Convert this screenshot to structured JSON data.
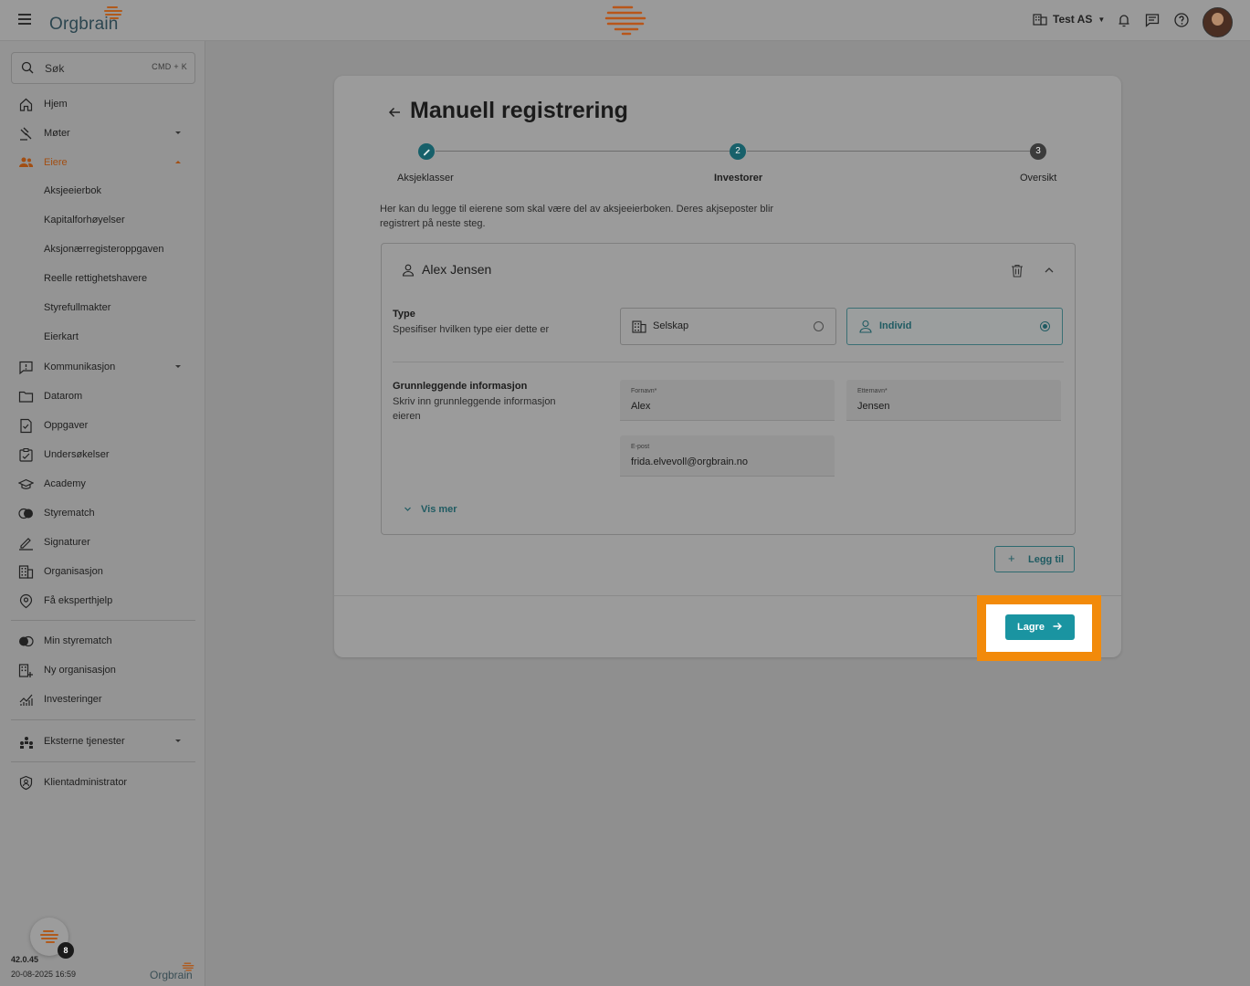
{
  "topbar": {
    "logo_text": "Orgbrain",
    "org_name": "Test AS"
  },
  "search": {
    "label": "Søk",
    "shortcut": "CMD + K"
  },
  "sidebar": {
    "items": [
      {
        "label": "Hjem",
        "icon": "home-icon"
      },
      {
        "label": "Møter",
        "icon": "gavel-icon",
        "expandable": true
      },
      {
        "label": "Eiere",
        "icon": "people-icon",
        "expandable": true,
        "active": true
      },
      {
        "label": "Kommunikasjon",
        "icon": "chat-alert-icon",
        "expandable": true
      },
      {
        "label": "Datarom",
        "icon": "folder-icon"
      },
      {
        "label": "Oppgaver",
        "icon": "task-icon"
      },
      {
        "label": "Undersøkelser",
        "icon": "survey-icon"
      },
      {
        "label": "Academy",
        "icon": "graduation-cap-icon"
      },
      {
        "label": "Styrematch",
        "icon": "circles-icon"
      },
      {
        "label": "Signaturer",
        "icon": "pen-icon"
      },
      {
        "label": "Organisasjon",
        "icon": "building-icon"
      },
      {
        "label": "Få eksperthjelp",
        "icon": "expert-icon"
      }
    ],
    "sub_items": [
      "Aksjeeierbok",
      "Kapitalforhøyelser",
      "Aksjonærregisteroppgaven",
      "Reelle rettighetshavere",
      "Styrefullmakter",
      "Eierkart"
    ],
    "extra_items": [
      {
        "label": "Min styrematch",
        "icon": "circles-icon"
      },
      {
        "label": "Ny organisasjon",
        "icon": "building-add-icon"
      },
      {
        "label": "Investeringer",
        "icon": "chart-icon"
      }
    ],
    "external": {
      "label": "Eksterne tjenester",
      "icon": "apps-icon"
    },
    "admin": {
      "label": "Klientadministrator",
      "icon": "shield-icon"
    },
    "version": "42.0.45",
    "date": "20-08-2025 16:59",
    "bottom_logo": "Orgbrain",
    "fab_badge": "8"
  },
  "page": {
    "title": "Manuell registrering",
    "steps": [
      {
        "number": "",
        "label": "Aksjeklasser",
        "state": "done"
      },
      {
        "number": "2",
        "label": "Investorer",
        "state": "current"
      },
      {
        "number": "3",
        "label": "Oversikt",
        "state": "todo"
      }
    ],
    "intro": "Her kan du legge til eierene som skal være del av aksjeeierboken. Deres akjseposter blir registrert på neste steg."
  },
  "investor": {
    "name": "Alex Jensen",
    "type_title": "Type",
    "type_sub": "Spesifiser hvilken type eier dette er",
    "type_options": [
      {
        "label": "Selskap",
        "selected": false
      },
      {
        "label": "Individ",
        "selected": true
      }
    ],
    "info_title": "Grunnleggende informasjon",
    "info_sub": "Skriv inn grunnleggende informasjon eieren",
    "fields": {
      "first_name": {
        "label": "Fornavn*",
        "value": "Alex"
      },
      "last_name": {
        "label": "Etternavn*",
        "value": "Jensen"
      },
      "email": {
        "label": "E-post",
        "value": "frida.elvevoll@orgbrain.no"
      }
    },
    "show_more": "Vis mer"
  },
  "actions": {
    "add": "Legg til",
    "save": "Lagre"
  },
  "colors": {
    "accent": "#1a94a1",
    "brand_orange": "#f28a0a",
    "highlight": "#f28a0a"
  }
}
